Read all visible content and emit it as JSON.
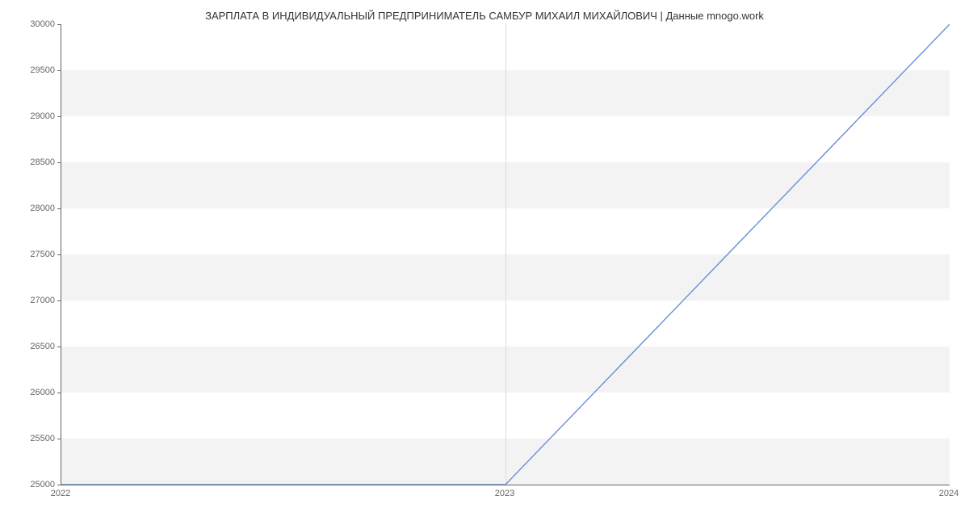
{
  "chart_data": {
    "type": "line",
    "title": "ЗАРПЛАТА В ИНДИВИДУАЛЬНЫЙ ПРЕДПРИНИМАТЕЛЬ САМБУР МИХАИЛ МИХАЙЛОВИЧ | Данные mnogo.work",
    "xlabel": "",
    "ylabel": "",
    "x_ticks": [
      "2022",
      "2023",
      "2024"
    ],
    "y_ticks": [
      25000,
      25500,
      26000,
      26500,
      27000,
      27500,
      28000,
      28500,
      29000,
      29500,
      30000
    ],
    "xlim": [
      2022,
      2024
    ],
    "ylim": [
      25000,
      30000
    ],
    "series": [
      {
        "name": "salary",
        "color": "#6a8fd8",
        "x": [
          2022,
          2023,
          2024
        ],
        "y": [
          25000,
          25000,
          30000
        ]
      }
    ],
    "grid": true
  }
}
